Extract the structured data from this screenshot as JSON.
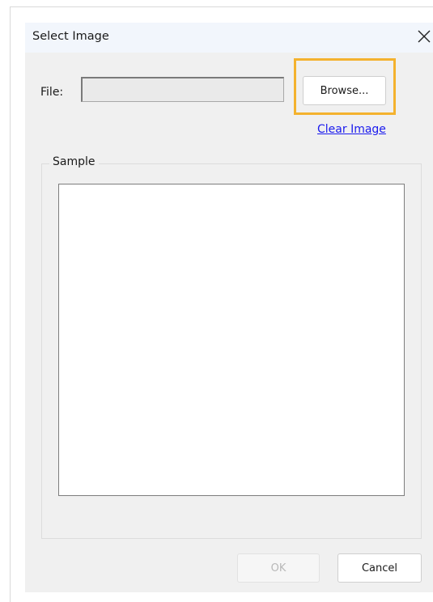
{
  "dialog": {
    "title": "Select Image",
    "close_icon": "close-icon"
  },
  "file": {
    "label": "File:",
    "value": "",
    "browse_label": "Browse..."
  },
  "clear_image_label": "Clear Image",
  "sample": {
    "label": "Sample"
  },
  "buttons": {
    "ok_label": "OK",
    "ok_enabled": false,
    "cancel_label": "Cancel"
  },
  "colors": {
    "highlight": "#f4b22e",
    "link": "#1a1aee",
    "dialog_background": "#f0f0f0",
    "titlebar_background": "#f2f6fc"
  }
}
